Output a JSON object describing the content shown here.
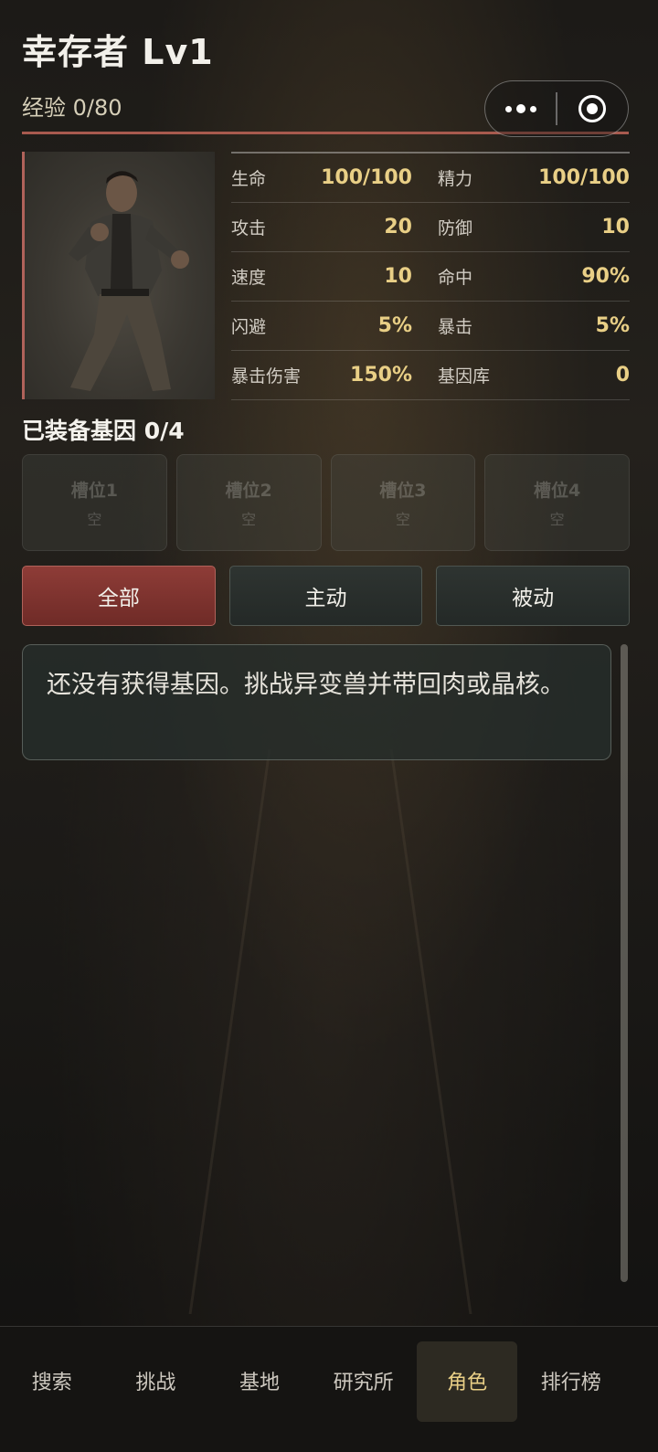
{
  "header": {
    "title": "幸存者 Lv1",
    "exp_text": "经验 0/80",
    "exp_progress": 0.0
  },
  "capsule": {
    "more_icon": "more-dots-icon",
    "close_icon": "target-circle-icon"
  },
  "stats": [
    [
      {
        "label": "生命",
        "value": "100/100"
      },
      {
        "label": "精力",
        "value": "100/100"
      }
    ],
    [
      {
        "label": "攻击",
        "value": "20"
      },
      {
        "label": "防御",
        "value": "10"
      }
    ],
    [
      {
        "label": "速度",
        "value": "10"
      },
      {
        "label": "命中",
        "value": "90%"
      }
    ],
    [
      {
        "label": "闪避",
        "value": "5%"
      },
      {
        "label": "暴击",
        "value": "5%"
      }
    ],
    [
      {
        "label": "暴击伤害",
        "value": "150%"
      },
      {
        "label": "基因库",
        "value": "0"
      }
    ]
  ],
  "equipped": {
    "title": "已装备基因 0/4",
    "slots": [
      {
        "name": "槽位1",
        "state": "空"
      },
      {
        "name": "槽位2",
        "state": "空"
      },
      {
        "name": "槽位3",
        "state": "空"
      },
      {
        "name": "槽位4",
        "state": "空"
      }
    ]
  },
  "filters": [
    {
      "label": "全部",
      "active": true
    },
    {
      "label": "主动",
      "active": false
    },
    {
      "label": "被动",
      "active": false
    }
  ],
  "empty_message": "还没有获得基因。挑战异变兽并带回肉或晶核。",
  "tabs": [
    {
      "label": "搜索",
      "active": false
    },
    {
      "label": "挑战",
      "active": false
    },
    {
      "label": "基地",
      "active": false
    },
    {
      "label": "研究所",
      "active": false
    },
    {
      "label": "角色",
      "active": true
    },
    {
      "label": "排行榜",
      "active": false
    }
  ],
  "colors": {
    "accent_gold": "#e9cf86",
    "accent_red": "#8e3c37",
    "exp_bar": "#a85a4e"
  }
}
